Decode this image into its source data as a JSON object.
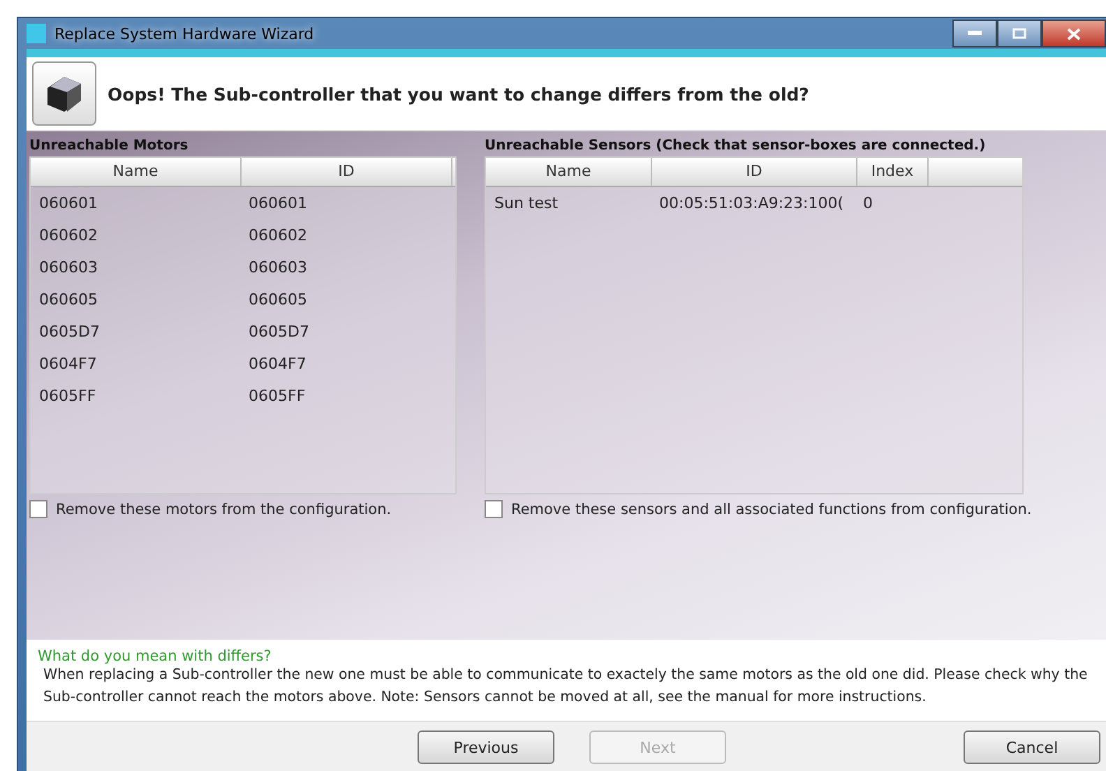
{
  "window": {
    "title": "Replace System Hardware Wizard"
  },
  "header": {
    "message": "Oops! The Sub-controller that you want to change differs from the old?"
  },
  "motors": {
    "title": "Unreachable Motors",
    "columns": [
      "Name",
      "ID"
    ],
    "rows": [
      [
        "060601",
        "060601"
      ],
      [
        "060602",
        "060602"
      ],
      [
        "060603",
        "060603"
      ],
      [
        "060605",
        "060605"
      ],
      [
        "0605D7",
        "0605D7"
      ],
      [
        "0604F7",
        "0604F7"
      ],
      [
        "0605FF",
        "0605FF"
      ]
    ],
    "remove_option": {
      "label": "Remove these motors from the configuration.",
      "checked": false
    }
  },
  "sensors": {
    "title": "Unreachable Sensors (Check that sensor-boxes are connected.)",
    "columns": [
      "Name",
      "ID",
      "Index"
    ],
    "rows": [
      [
        "Sun test",
        "00:05:51:03:A9:23:100(",
        "0"
      ]
    ],
    "remove_option": {
      "label": "Remove these sensors and all associated functions from configuration.",
      "checked": false
    }
  },
  "help": {
    "title": "What do you mean with differs?",
    "text": "When replacing a Sub-controller the new one must be able to communicate to exactely the same motors as the old one did. Please check why the Sub-controller cannot reach the motors above. Note: Sensors cannot be moved at all, see the manual for more instructions."
  },
  "buttons": [
    {
      "label": "Previous",
      "disabled": false
    },
    {
      "label": "Next",
      "disabled": true
    },
    {
      "label": "Cancel",
      "disabled": false
    }
  ]
}
